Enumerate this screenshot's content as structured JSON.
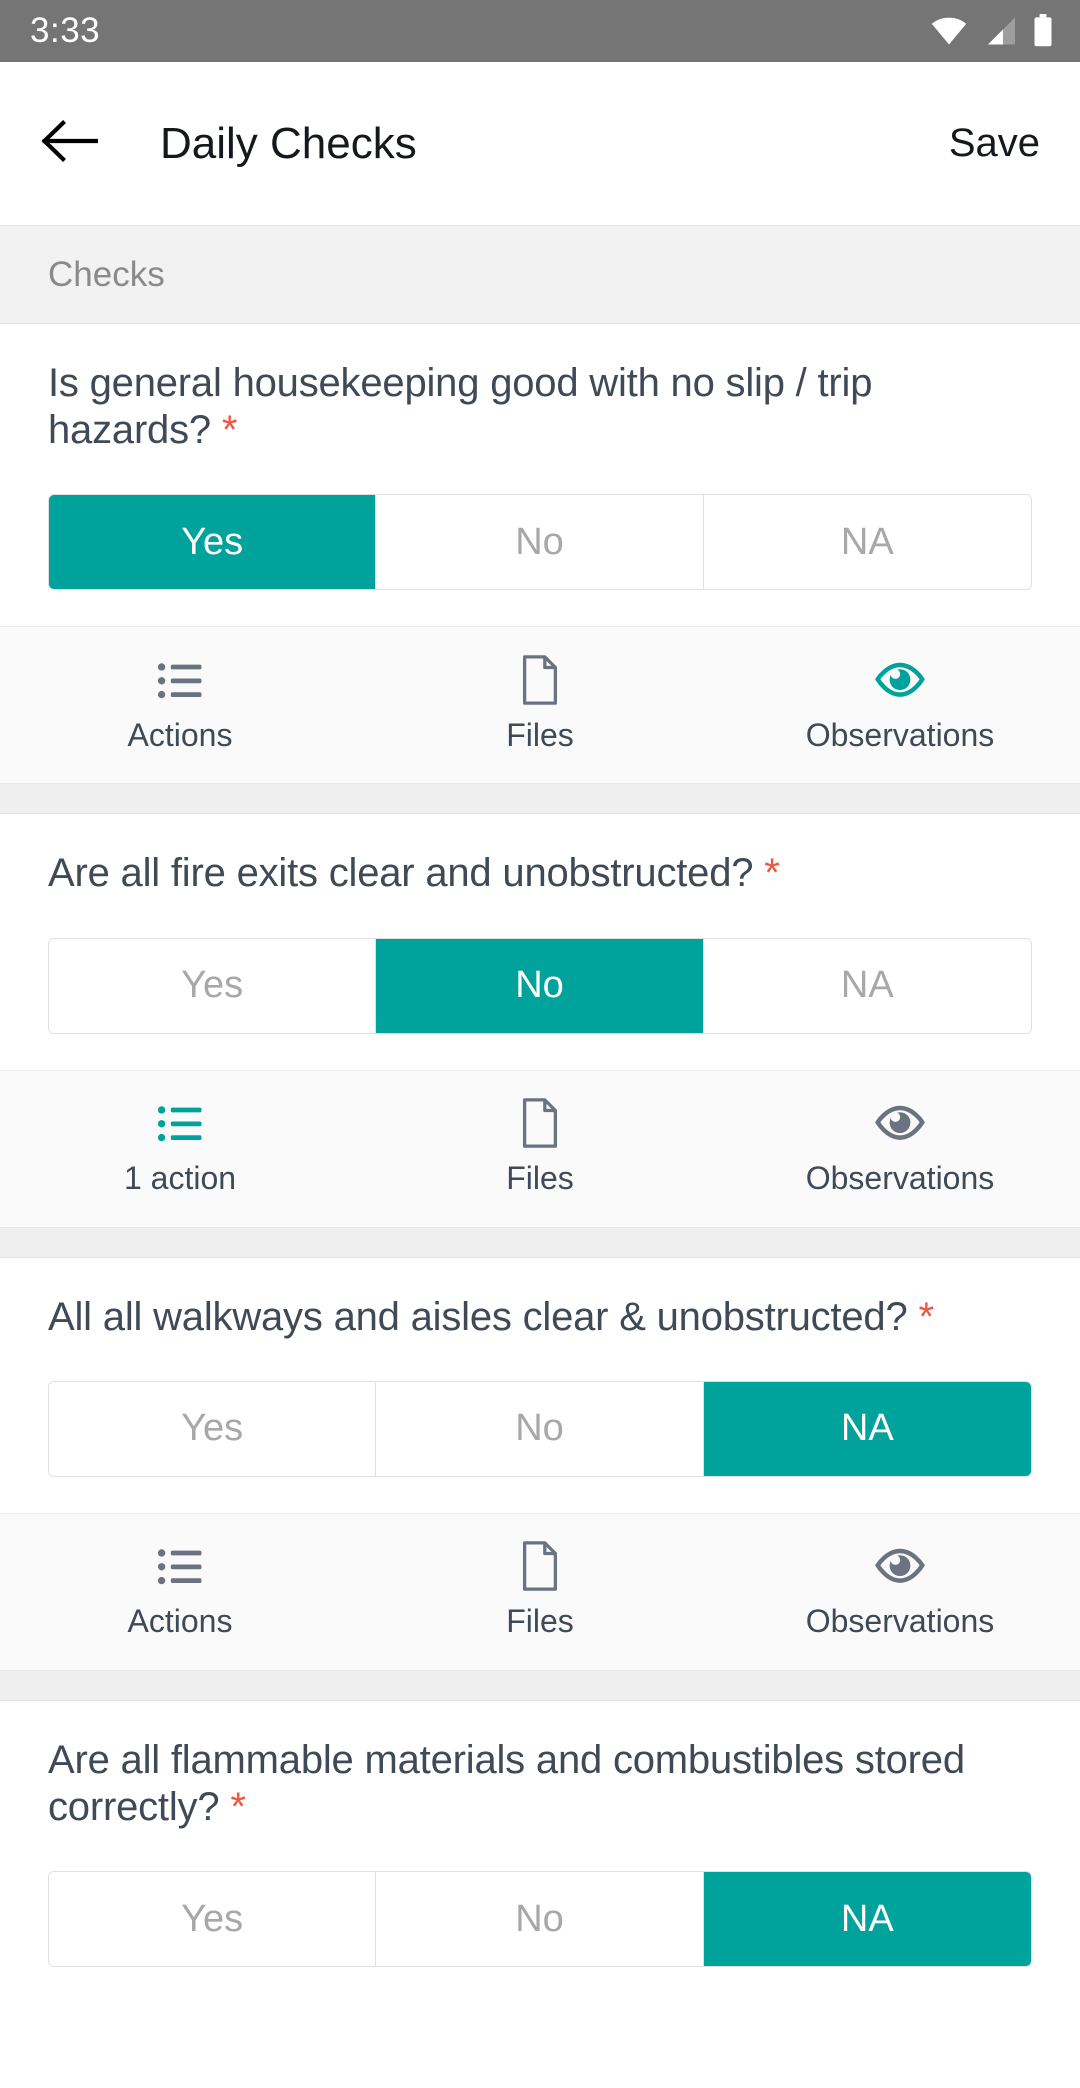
{
  "status_bar": {
    "clock": "3:33",
    "icons": [
      "wifi-icon",
      "cellular-signal-icon",
      "battery-icon"
    ]
  },
  "app_bar": {
    "back_icon": "back-arrow-icon",
    "title": "Daily Checks",
    "save_label": "Save"
  },
  "theme": {
    "accent": "#00a39b",
    "required_marker": "#f0563f",
    "question_text": "#3f4a56",
    "status_bar_bg": "#757575",
    "section_bg": "#f2f2f2",
    "action_bar_bg": "#fafafa"
  },
  "section": {
    "label": "Checks"
  },
  "answer_options": [
    "Yes",
    "No",
    "NA"
  ],
  "required_marker": "*",
  "questions": [
    {
      "text": "Is general housekeeping good with no slip / trip hazards?",
      "required": true,
      "selected": "Yes",
      "actions": [
        {
          "icon": "list-icon",
          "label": "Actions",
          "active": false
        },
        {
          "icon": "file-icon",
          "label": "Files",
          "active": false
        },
        {
          "icon": "eye-icon",
          "label": "Observations",
          "active": true
        }
      ]
    },
    {
      "text": "Are all fire exits clear and unobstructed?",
      "required": true,
      "selected": "No",
      "actions": [
        {
          "icon": "list-icon",
          "label": "1 action",
          "active": true
        },
        {
          "icon": "file-icon",
          "label": "Files",
          "active": false
        },
        {
          "icon": "eye-icon",
          "label": "Observations",
          "active": false
        }
      ]
    },
    {
      "text": "All all walkways and aisles clear & unobstructed?",
      "required": true,
      "selected": "NA",
      "actions": [
        {
          "icon": "list-icon",
          "label": "Actions",
          "active": false
        },
        {
          "icon": "file-icon",
          "label": "Files",
          "active": false
        },
        {
          "icon": "eye-icon",
          "label": "Observations",
          "active": false
        }
      ]
    },
    {
      "text": "Are all flammable materials and combustibles stored correctly?",
      "required": true,
      "selected": "NA",
      "actions": []
    }
  ]
}
